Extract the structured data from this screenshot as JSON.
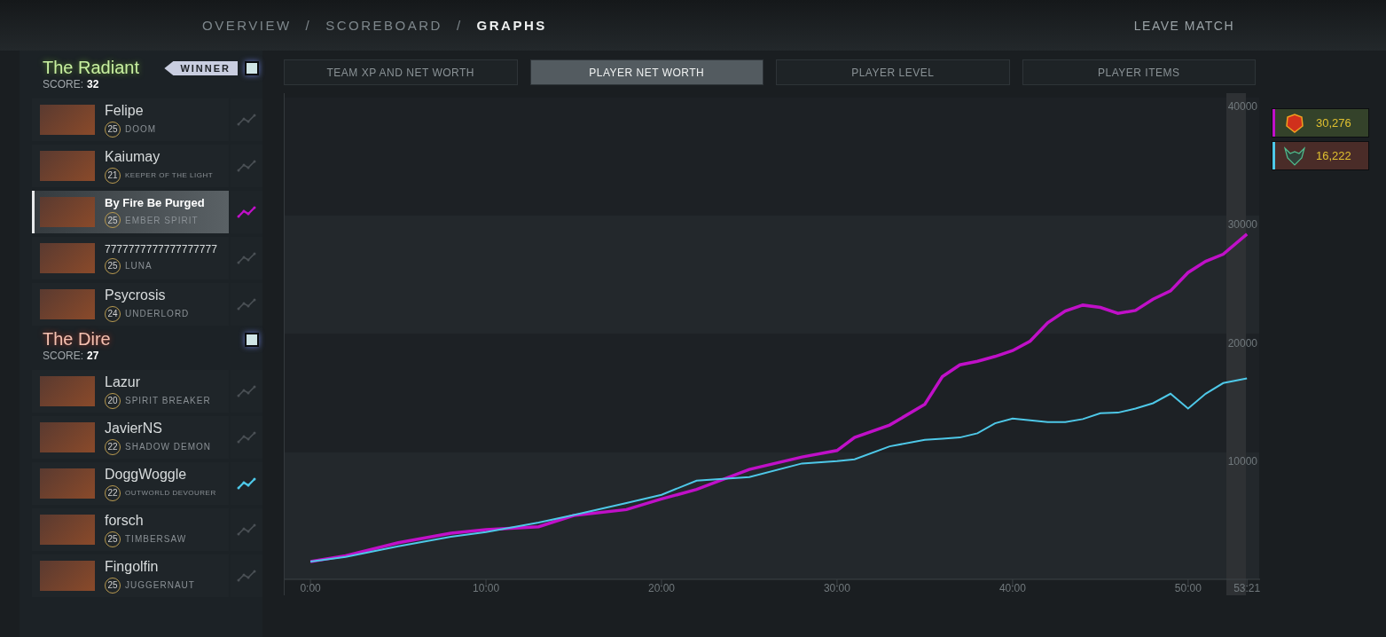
{
  "nav": {
    "items": [
      {
        "label": "OVERVIEW",
        "selected": false
      },
      {
        "label": "SCOREBOARD",
        "selected": false
      },
      {
        "label": "GRAPHS",
        "selected": true
      }
    ],
    "separator": "/",
    "leave": "LEAVE MATCH"
  },
  "teams": [
    {
      "name": "The Radiant",
      "kind": "radiant",
      "score_label": "SCORE:",
      "score": "32",
      "winner": "WINNER",
      "checked": true,
      "players": [
        {
          "name": "Felipe",
          "level": "25",
          "hero": "DOOM",
          "selected": false
        },
        {
          "name": "Kaiumay",
          "level": "21",
          "hero": "KEEPER OF THE LIGHT",
          "selected": false
        },
        {
          "name": "By Fire Be Purged",
          "level": "25",
          "hero": "EMBER SPIRIT",
          "selected": true,
          "color": "#c010c8"
        },
        {
          "name": "7777777777777777777",
          "level": "25",
          "hero": "LUNA",
          "selected": false
        },
        {
          "name": "Psycrosis",
          "level": "24",
          "hero": "UNDERLORD",
          "selected": false
        }
      ]
    },
    {
      "name": "The Dire",
      "kind": "dire",
      "score_label": "SCORE:",
      "score": "27",
      "checked": true,
      "players": [
        {
          "name": "Lazur",
          "level": "20",
          "hero": "SPIRIT BREAKER",
          "selected": false
        },
        {
          "name": "JavierNS",
          "level": "22",
          "hero": "SHADOW DEMON",
          "selected": false
        },
        {
          "name": "DoggWoggle",
          "level": "22",
          "hero": "OUTWORLD DEVOURER",
          "selected": false,
          "color": "#4ec8e8"
        },
        {
          "name": "forsch",
          "level": "25",
          "hero": "TIMBERSAW",
          "selected": false
        },
        {
          "name": "Fingolfin",
          "level": "25",
          "hero": "JUGGERNAUT",
          "selected": false
        }
      ]
    }
  ],
  "tabs": [
    {
      "label": "TEAM XP AND NET WORTH",
      "selected": false
    },
    {
      "label": "PLAYER NET WORTH",
      "selected": true
    },
    {
      "label": "PLAYER LEVEL",
      "selected": false
    },
    {
      "label": "PLAYER ITEMS",
      "selected": false
    }
  ],
  "chart_data": {
    "type": "line",
    "x": [
      0,
      2,
      5,
      8,
      10,
      13,
      15,
      18,
      20,
      22,
      25,
      28,
      30,
      31,
      33,
      35,
      36,
      37,
      38,
      39,
      40,
      41,
      42,
      43,
      44,
      45,
      46,
      47,
      48,
      49,
      50,
      51,
      52,
      53.35
    ],
    "series": [
      {
        "color": "#c010c8",
        "values": [
          1500,
          2000,
          3100,
          3900,
          4200,
          4450,
          5400,
          5900,
          6800,
          7600,
          9300,
          10350,
          10900,
          12000,
          13050,
          14800,
          17150,
          18150,
          18450,
          18850,
          19350,
          20150,
          21700,
          22700,
          23200,
          23000,
          22500,
          22750,
          23700,
          24400,
          25950,
          26900,
          27500,
          29200
        ]
      },
      {
        "color": "#4ec8e8",
        "values": [
          1500,
          1900,
          2800,
          3600,
          4000,
          4800,
          5450,
          6450,
          7150,
          8350,
          8650,
          9800,
          10000,
          10150,
          11250,
          11800,
          11900,
          12000,
          12350,
          13200,
          13600,
          13450,
          13300,
          13300,
          13550,
          14050,
          14100,
          14450,
          14900,
          15700,
          14450,
          15700,
          16600,
          17000
        ]
      }
    ],
    "xlim": [
      -1.47,
      54.1
    ],
    "ylim": [
      0,
      41126
    ],
    "xticks": [
      {
        "value": 0,
        "label": "0:00"
      },
      {
        "value": 10,
        "label": "10:00"
      },
      {
        "value": 20,
        "label": "20:00"
      },
      {
        "value": 30,
        "label": "30:00"
      },
      {
        "value": 40,
        "label": "40:00"
      },
      {
        "value": 50,
        "label": "50:00"
      },
      {
        "value": 53.35,
        "label": "53:21"
      }
    ],
    "yticks": [
      10000,
      20000,
      30000,
      40000
    ]
  },
  "legend": [
    {
      "kind": "radiant",
      "color": "#c010c8",
      "value": "30,276"
    },
    {
      "kind": "dire",
      "color": "#4ec8e8",
      "value": "16,222"
    }
  ]
}
